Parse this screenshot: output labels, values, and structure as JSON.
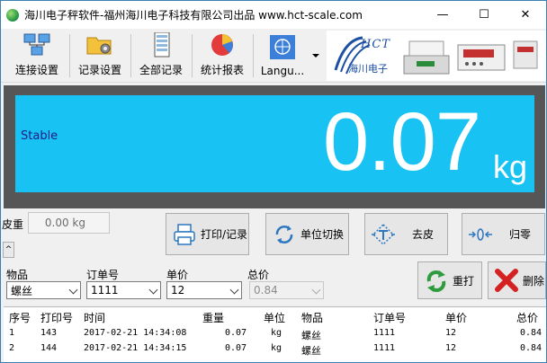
{
  "window": {
    "title": "海川电子秤软件-福州海川电子科技有限公司出品 www.hct-scale.com",
    "minimize": "—",
    "maximize": "☐",
    "close": "✕"
  },
  "toolbar": {
    "items": [
      {
        "label": "连接设置",
        "icon": "network-icon"
      },
      {
        "label": "记录设置",
        "icon": "folder-gear-icon"
      },
      {
        "label": "全部记录",
        "icon": "document-list-icon"
      },
      {
        "label": "统计报表",
        "icon": "pie-chart-icon"
      },
      {
        "label": "Langu...",
        "icon": "globe-icon"
      }
    ],
    "brand": {
      "logo_text": "HCT",
      "cn": "海川电子"
    }
  },
  "display": {
    "status": "Stable",
    "weight": "0.07",
    "unit": "kg",
    "bg_color": "#18c2f2"
  },
  "tare": {
    "label": "皮重",
    "value": "0.00 kg",
    "collapse": "^"
  },
  "actions": {
    "print_record": "打印/记录",
    "switch_unit": "单位切换",
    "tare": "去皮",
    "zero": "归零",
    "reprint": "重打",
    "delete": "删除"
  },
  "fields": {
    "product_label": "物品",
    "product_value": "螺丝",
    "order_label": "订单号",
    "order_value": "1111",
    "price_label": "单价",
    "price_value": "12",
    "total_label": "总价",
    "total_value": "0.84"
  },
  "table": {
    "columns": [
      "序号",
      "打印号",
      "时间",
      "重量",
      "单位",
      "物品",
      "订单号",
      "单价",
      "总价"
    ],
    "rows": [
      [
        "1",
        "143",
        "2017-02-21 14:34:08",
        "0.07",
        "kg",
        "螺丝",
        "1111",
        "12",
        "0.84"
      ],
      [
        "2",
        "144",
        "2017-02-21 14:34:15",
        "0.07",
        "kg",
        "螺丝",
        "1111",
        "12",
        "0.84"
      ]
    ]
  }
}
